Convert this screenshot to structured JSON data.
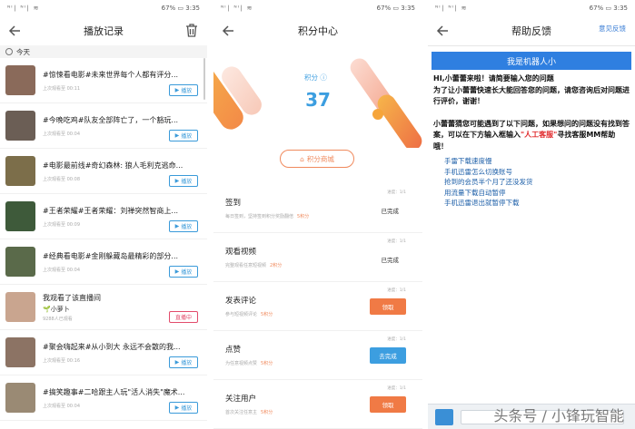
{
  "status": {
    "left_signal": "ᴺᴵ∣ᴺᴵ∣ ≈",
    "battery_text": "67%",
    "time": "3:35"
  },
  "playback": {
    "title": "播放记录",
    "today_label": "今天",
    "items": [
      {
        "title": "#惊悚看电影#未来世界每个人都有评分...",
        "sub": "上次观看至 00:11",
        "button": "播放",
        "thumb_color": "#8a6a5a"
      },
      {
        "title": "#今晚吃鸡#队友全部阵亡了，一个豁玩...",
        "sub": "上次观看至 00:04",
        "button": "播放",
        "thumb_color": "#6b5e55"
      },
      {
        "title": "#电影最前线#奇幻森林: 狼人毛利克逃命...",
        "sub": "上次观看至 00:08",
        "button": "播放",
        "thumb_color": "#7c6e4a"
      },
      {
        "title": "#王者荣耀#王者荣耀：刘禅突然智商上...",
        "sub": "上次观看至 00:09",
        "button": "播放",
        "thumb_color": "#3e5a3a"
      },
      {
        "title": "#经典看电影#金刚躲藏岛最精彩的部分...",
        "sub": "上次观看至 00:04",
        "button": "播放",
        "thumb_color": "#5a6a4a"
      },
      {
        "title": "我观看了该直播间",
        "extra": "🌱小萝卜",
        "sub": "9288人已观看",
        "button": "直播中",
        "thumb_color": "#c9a58f",
        "live": true
      },
      {
        "title": "#聚会嗨起来#从小到大 永远不会散的我...",
        "sub": "上次观看至 00:16",
        "button": "播放",
        "thumb_color": "#8c7364"
      },
      {
        "title": "#搞笑趣事#二哈跟主人玩\"活人消失\"魔术...",
        "sub": "上次观看至 00:04",
        "button": "播放",
        "thumb_color": "#9a8a74"
      }
    ]
  },
  "points": {
    "title": "积分中心",
    "points_label": "积分 ⓘ",
    "points_value": "37",
    "mall_button": "积分商城",
    "tasks": [
      {
        "name": "签到",
        "desc": "每日签到，坚持签到积分奖励翻倍",
        "pts": "5积分",
        "progress": "进度：1/1",
        "status": "已完成"
      },
      {
        "name": "观看视频",
        "desc": "完整观看任意短视频",
        "pts": "2积分",
        "progress": "进度：1/1",
        "status": "已完成"
      },
      {
        "name": "发表评论",
        "desc": "参与短视频评论",
        "pts": "5积分",
        "progress": "进度：1/1",
        "button": "领取",
        "button_color": "#f07a45"
      },
      {
        "name": "点赞",
        "desc": "为任意视频点赞",
        "pts": "5积分",
        "progress": "进度：1/1",
        "button": "去完成",
        "button_color": "#3c9ee0"
      },
      {
        "name": "关注用户",
        "desc": "首次关注任意主",
        "pts": "5积分",
        "progress": "进度：1/1",
        "button": "领取",
        "button_color": "#f07a45"
      }
    ]
  },
  "help": {
    "title": "帮助反馈",
    "right_link": "意见反馈",
    "robot_banner": "我是机器人小",
    "intro": "HI,小蕾蕾来啦！请简要输入您的问题\n为了让小蕾蕾快速长大能回答您的问题，请您咨询后对问题进行评价，谢谢！",
    "guess_prefix": "小蕾蕾猜您可能遇到了以下问题，如果想问的问题没有找到答案，可以在下方输入框输入",
    "guess_highlight": "\"人工客服\"",
    "guess_suffix": "寻找客服MM帮助哦！",
    "links": [
      "手雷下载速度慢",
      "手机迅雷怎么切换账号",
      "抢到的会员半个月了还没发货",
      "用流量下载自动暂停",
      "手机迅雷退出就暂停下载"
    ],
    "watermark": "头条号 / 小锋玩智能"
  }
}
